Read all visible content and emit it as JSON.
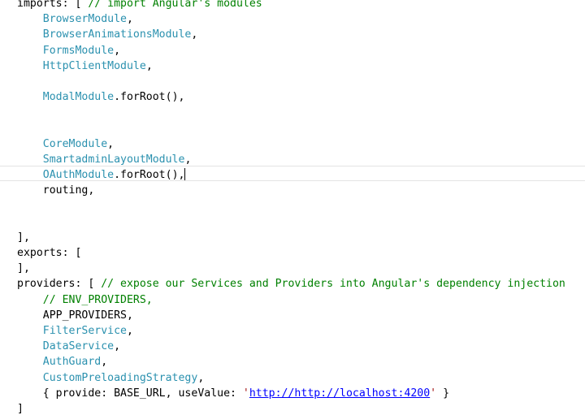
{
  "editor": {
    "lines": [
      {
        "indent": "",
        "tokens": [
          {
            "t": "imports: [ ",
            "c": "t-plain"
          },
          {
            "t": "// import Angular's modules",
            "c": "t-comment"
          }
        ]
      },
      {
        "indent": "    ",
        "tokens": [
          {
            "t": "BrowserModule",
            "c": "t-type"
          },
          {
            "t": ",",
            "c": "t-punct"
          }
        ]
      },
      {
        "indent": "    ",
        "tokens": [
          {
            "t": "BrowserAnimationsModule",
            "c": "t-type"
          },
          {
            "t": ",",
            "c": "t-punct"
          }
        ]
      },
      {
        "indent": "    ",
        "tokens": [
          {
            "t": "FormsModule",
            "c": "t-type"
          },
          {
            "t": ",",
            "c": "t-punct"
          }
        ]
      },
      {
        "indent": "    ",
        "tokens": [
          {
            "t": "HttpClientModule",
            "c": "t-type"
          },
          {
            "t": ",",
            "c": "t-punct"
          }
        ]
      },
      {
        "indent": "",
        "tokens": []
      },
      {
        "indent": "    ",
        "tokens": [
          {
            "t": "ModalModule",
            "c": "t-type"
          },
          {
            "t": ".forRoot(),",
            "c": "t-plain"
          }
        ]
      },
      {
        "indent": "",
        "tokens": []
      },
      {
        "indent": "",
        "tokens": []
      },
      {
        "indent": "    ",
        "tokens": [
          {
            "t": "CoreModule",
            "c": "t-type"
          },
          {
            "t": ",",
            "c": "t-punct"
          }
        ]
      },
      {
        "indent": "    ",
        "tokens": [
          {
            "t": "SmartadminLayoutModule",
            "c": "t-type"
          },
          {
            "t": ",",
            "c": "t-punct"
          }
        ]
      },
      {
        "indent": "    ",
        "tokens": [
          {
            "t": "OAuthModule",
            "c": "t-type"
          },
          {
            "t": ".forRoot(),",
            "c": "t-plain"
          }
        ],
        "caret": true
      },
      {
        "indent": "    ",
        "tokens": [
          {
            "t": "routing,",
            "c": "t-plain"
          }
        ]
      },
      {
        "indent": "",
        "tokens": []
      },
      {
        "indent": "",
        "tokens": []
      },
      {
        "indent": "",
        "tokens": [
          {
            "t": "],",
            "c": "t-plain"
          }
        ]
      },
      {
        "indent": "",
        "tokens": [
          {
            "t": "exports: [",
            "c": "t-plain"
          }
        ]
      },
      {
        "indent": "",
        "tokens": [
          {
            "t": "],",
            "c": "t-plain"
          }
        ]
      },
      {
        "indent": "",
        "tokens": [
          {
            "t": "providers: [ ",
            "c": "t-plain"
          },
          {
            "t": "// expose our Services and Providers into Angular's dependency injection",
            "c": "t-comment"
          }
        ]
      },
      {
        "indent": "    ",
        "tokens": [
          {
            "t": "// ENV_PROVIDERS,",
            "c": "t-comment"
          }
        ]
      },
      {
        "indent": "    ",
        "tokens": [
          {
            "t": "APP_PROVIDERS,",
            "c": "t-plain"
          }
        ]
      },
      {
        "indent": "    ",
        "tokens": [
          {
            "t": "FilterService",
            "c": "t-type"
          },
          {
            "t": ",",
            "c": "t-punct"
          }
        ]
      },
      {
        "indent": "    ",
        "tokens": [
          {
            "t": "DataService",
            "c": "t-type"
          },
          {
            "t": ",",
            "c": "t-punct"
          }
        ]
      },
      {
        "indent": "    ",
        "tokens": [
          {
            "t": "AuthGuard",
            "c": "t-type"
          },
          {
            "t": ",",
            "c": "t-punct"
          }
        ]
      },
      {
        "indent": "    ",
        "tokens": [
          {
            "t": "CustomPreloadingStrategy",
            "c": "t-type"
          },
          {
            "t": ",",
            "c": "t-punct"
          }
        ]
      },
      {
        "indent": "    ",
        "tokens": [
          {
            "t": "{ provide: BASE_URL, useValue: ",
            "c": "t-plain"
          },
          {
            "t": "'",
            "c": "t-string"
          },
          {
            "t": "http://http://localhost:4200",
            "c": "t-url"
          },
          {
            "t": "'",
            "c": "t-string"
          },
          {
            "t": " }",
            "c": "t-plain"
          }
        ]
      },
      {
        "indent": "",
        "tokens": [
          {
            "t": "]",
            "c": "t-plain"
          }
        ]
      }
    ]
  }
}
